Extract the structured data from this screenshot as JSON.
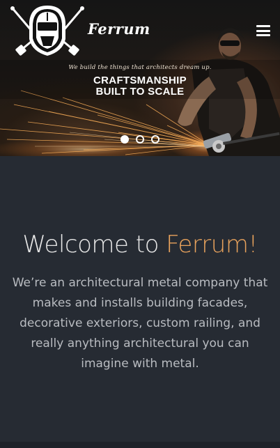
{
  "header": {
    "brand_name": "Ferrum",
    "logo_icon": "welder-helmet-crossed-torches-logo",
    "menu_icon": "hamburger-menu-icon"
  },
  "hero": {
    "tagline": "We build the things that architects dream up.",
    "headline_line1": "CRAFTSMANSHIP",
    "headline_line2": "BUILT TO SCALE",
    "slide_count": 3,
    "active_slide": 1
  },
  "welcome": {
    "title_prefix": "Welcome to ",
    "title_accent": "Ferrum!",
    "body": "We’re an architectural metal company that makes and installs building facades, decorative exteriors, custom railing, and really anything architectural you can imagine with metal."
  },
  "colors": {
    "accent": "#e8a25c",
    "background": "#262b33",
    "body_text": "#b9bcc1"
  }
}
